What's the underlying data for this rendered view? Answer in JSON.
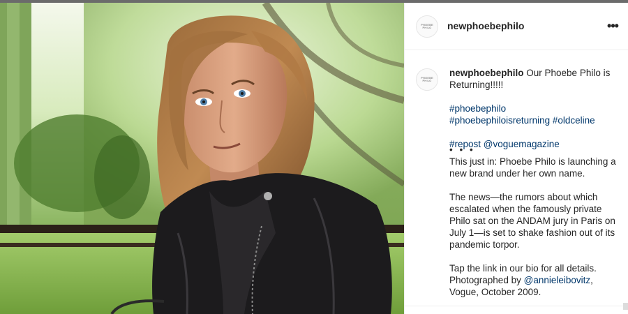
{
  "post": {
    "username": "newphoebephilo",
    "avatar_text": "PHOEBE PHILO",
    "more_label": "•••",
    "caption": {
      "username": "newphoebephilo",
      "text": "Our Phoebe Philo is Returning!!!!!",
      "hashtags_line1": "#phoebephilo",
      "hashtags_line2a": "#phoebephiloisreturning",
      "hashtags_line2b": "#oldceline",
      "repost": "#repost",
      "repost_handle": "@voguemagazine",
      "dots": "• • •",
      "para1": "This just in: Phoebe Philo is launching a new brand under her own name.",
      "para2": "The news—the rumors about which escalated when the famously private Philo sat on the ANDAM jury in Paris on July 1—is set to shake fashion out of its pandemic torpor.",
      "para3a": "Tap the link in our bio for all details. Photographed by",
      "para3_handle": "@annieleibovitz",
      "para3b": ", Vogue, October 2009."
    }
  },
  "icons": {
    "more": "more-options-icon"
  }
}
